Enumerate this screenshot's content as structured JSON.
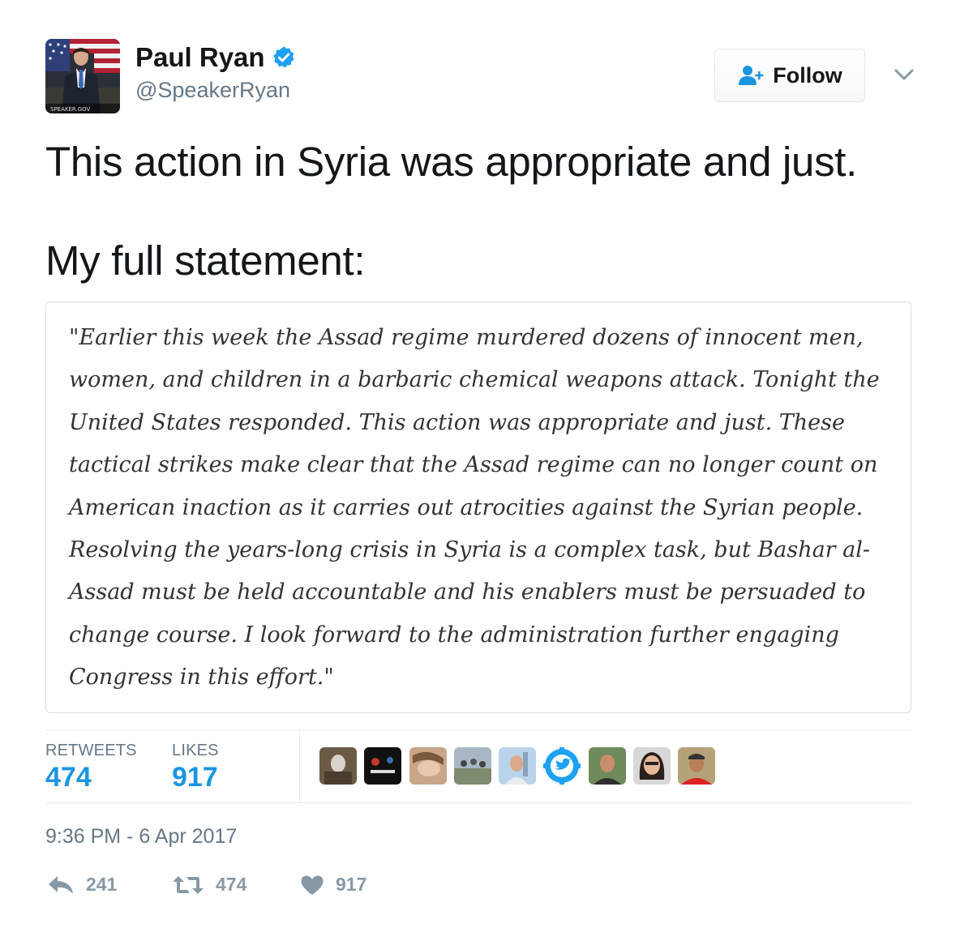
{
  "user": {
    "display_name": "Paul Ryan",
    "handle": "@SpeakerRyan",
    "avatar_caption": "SPEAKER.GOV",
    "verified": true
  },
  "follow_button": {
    "label": "Follow"
  },
  "tweet": {
    "text_line1": "This action in Syria was appropriate and just.",
    "text_line2": "My full statement:"
  },
  "statement": {
    "lines": [
      "\"Earlier this week the Assad regime murdered dozens of innocent men,",
      "women, and children in a barbaric chemical weapons attack. Tonight the",
      "United States responded. This action was appropriate and just. These",
      "tactical strikes make clear that the Assad regime can no longer count on",
      "American inaction as it carries out atrocities against the Syrian people.",
      "Resolving the years-long crisis in Syria is a complex task, but Bashar al-",
      "Assad must be held accountable and his enablers must be persuaded to",
      "change course. I look forward to the administration further engaging",
      "Congress in this effort.\""
    ]
  },
  "stats": {
    "retweets_label": "RETWEETS",
    "retweets_value": "474",
    "likes_label": "LIKES",
    "likes_value": "917"
  },
  "likers": [
    {
      "icon": "user-avatar-1"
    },
    {
      "icon": "user-avatar-2"
    },
    {
      "icon": "user-avatar-3"
    },
    {
      "icon": "user-avatar-4"
    },
    {
      "icon": "user-avatar-5"
    },
    {
      "icon": "twitter-bird-avatar"
    },
    {
      "icon": "user-avatar-7"
    },
    {
      "icon": "user-avatar-8"
    },
    {
      "icon": "user-avatar-9"
    }
  ],
  "timestamp": "9:36 PM - 6 Apr 2017",
  "actions": {
    "reply_count": "241",
    "retweet_count": "474",
    "like_count": "917"
  },
  "colors": {
    "accent": "#1b95e0",
    "muted": "#657786",
    "action_gray": "#8899a6",
    "verified_blue": "#1da1f2"
  }
}
